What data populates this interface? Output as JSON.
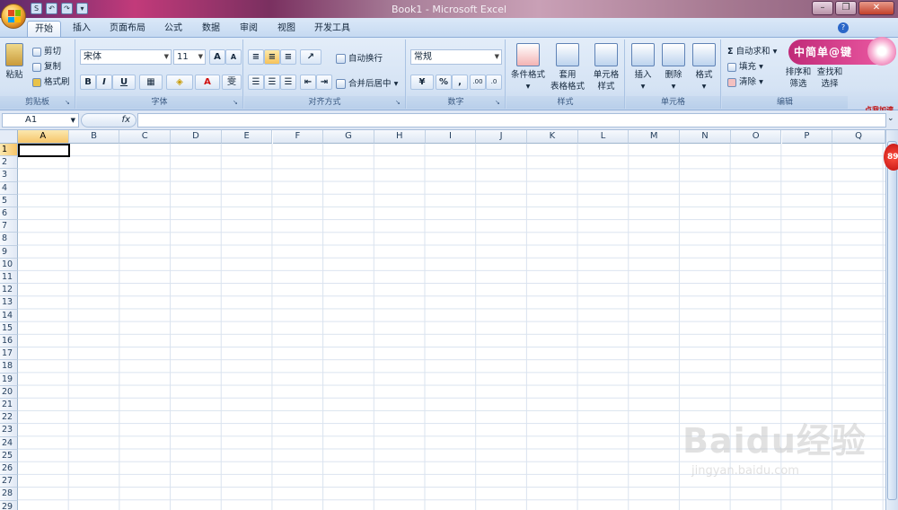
{
  "window": {
    "title": "Book1 - Microsoft Excel",
    "controls": {
      "minimize": "–",
      "restore": "❐",
      "close": "✕"
    }
  },
  "qat": {
    "save": "S",
    "undo": "↶",
    "redo": "↷",
    "more": "▾"
  },
  "tabs": [
    {
      "label": "开始",
      "active": true
    },
    {
      "label": "插入"
    },
    {
      "label": "页面布局"
    },
    {
      "label": "公式"
    },
    {
      "label": "数据"
    },
    {
      "label": "审阅"
    },
    {
      "label": "视图"
    },
    {
      "label": "开发工具"
    }
  ],
  "ribbon": {
    "clipboard": {
      "label": "剪贴板",
      "paste": "粘贴",
      "cut": "剪切",
      "copy": "复制",
      "format_painter": "格式刷"
    },
    "font": {
      "label": "字体",
      "family": "宋体",
      "size": "11",
      "bold": "B",
      "italic": "I",
      "underline": "U",
      "grow": "A",
      "shrink": "A",
      "font_color": "A",
      "phonetic": "雯"
    },
    "alignment": {
      "label": "对齐方式",
      "wrap": "自动换行",
      "merge": "合并后居中"
    },
    "number": {
      "label": "数字",
      "format": "常规",
      "percent": "%",
      "comma": ",",
      "inc_dec": ".00",
      "dec_dec": ".0"
    },
    "styles": {
      "label": "样式",
      "conditional": [
        "条件格式"
      ],
      "table": [
        "套用",
        "表格格式"
      ],
      "cell": [
        "单元格",
        "样式"
      ]
    },
    "cells": {
      "label": "单元格",
      "insert": "插入",
      "delete": "删除",
      "format": "格式"
    },
    "editing": {
      "label": "编辑",
      "autosum": "自动求和",
      "fill": "填充",
      "clear": "清除",
      "sort": [
        "排序和",
        "筛选"
      ],
      "find": [
        "查找和",
        "选择"
      ]
    }
  },
  "formula_bar": {
    "name_box": "A1",
    "fx": "fx",
    "content": ""
  },
  "sheet": {
    "columns": [
      "A",
      "B",
      "C",
      "D",
      "E",
      "F",
      "G",
      "H",
      "I",
      "J",
      "K",
      "L",
      "M",
      "N",
      "O",
      "P",
      "Q"
    ],
    "rows": [
      "1",
      "2",
      "3",
      "4",
      "5",
      "6",
      "7",
      "8",
      "9",
      "10",
      "11",
      "12",
      "13",
      "14",
      "15",
      "16",
      "17",
      "18",
      "19",
      "20",
      "21",
      "22",
      "23",
      "24",
      "25",
      "26",
      "27",
      "28",
      "29"
    ],
    "active_cell": "A1"
  },
  "overlays": {
    "ad_text": "中简单@键",
    "speedup": "点我加速",
    "badge": "89",
    "watermark": "Baidu经验",
    "watermark_url": "jingyan.baidu.com"
  },
  "colors": {
    "accent": "#c5d9f1",
    "title_gradient": "#c23a7a",
    "grid": "#dae3ef",
    "select": "#f6c56a"
  }
}
